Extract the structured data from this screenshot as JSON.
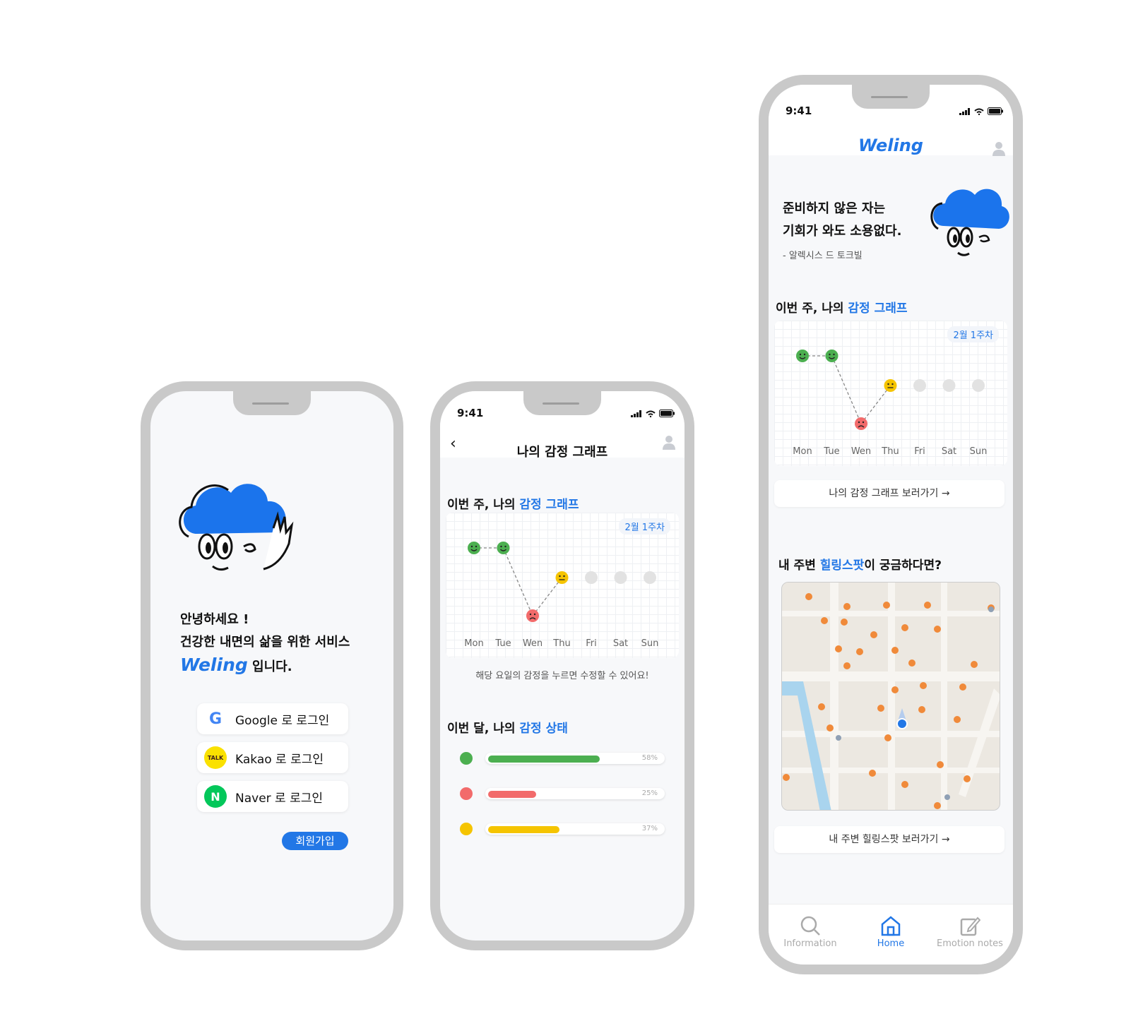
{
  "status": {
    "time": "9:41"
  },
  "login_screen": {
    "greeting_line1": "안녕하세요 !",
    "greeting_line2": "건강한 내면의 삶을 위한 서비스",
    "brand": "Weling",
    "greeting_suffix": "입니다.",
    "buttons": [
      {
        "label": "Google 로 로그인",
        "icon": "google-icon"
      },
      {
        "label": "Kakao 로 로그인",
        "icon": "kakao-icon"
      },
      {
        "label": "Naver 로 로그인",
        "icon": "naver-icon"
      }
    ],
    "signup_label": "회원가입",
    "kakao_icon_text": "TALK",
    "naver_icon_text": "N",
    "google_icon_text": "G"
  },
  "graph_screen": {
    "title": "나의 감정 그래프",
    "week_section": {
      "prefix": "이번 주, 나의 ",
      "highlight": "감정 그래프"
    },
    "week_pill": "2월 1주차",
    "days": [
      "Mon",
      "Tue",
      "Wen",
      "Thu",
      "Fri",
      "Sat",
      "Sun"
    ],
    "hint": "해당 요일의 감정을 누르면 수정할 수 있어요!",
    "month_section": {
      "prefix": "이번 달, 나의 ",
      "highlight": "감정 상태"
    },
    "month_bars": [
      {
        "mood": "happy",
        "percent": 58,
        "label": "58%",
        "color": "#4caf50"
      },
      {
        "mood": "sad",
        "percent": 25,
        "label": "25%",
        "color": "#f26b6b"
      },
      {
        "mood": "neutral",
        "percent": 37,
        "label": "37%",
        "color": "#f5c400"
      }
    ]
  },
  "home_screen": {
    "brand": "Weling",
    "quote_line1": "준비하지 않은 자는",
    "quote_line2": "기회가 와도 소용없다.",
    "quote_author": "- 알렉시스 드 토크빌",
    "week_section": {
      "prefix": "이번 주, 나의 ",
      "highlight": "감정 그래프"
    },
    "week_pill": "2월 1주차",
    "days": [
      "Mon",
      "Tue",
      "Wen",
      "Thu",
      "Fri",
      "Sat",
      "Sun"
    ],
    "graph_link": "나의 감정 그래프 보러가기 →",
    "spot_section": {
      "prefix": "내 주변 ",
      "highlight": "힐링스팟",
      "suffix": "이 궁금하다면?"
    },
    "spot_link": "내 주변 힐링스팟 보러가기 →",
    "tabs": [
      {
        "label": "Information",
        "icon": "search-icon",
        "active": false
      },
      {
        "label": "Home",
        "icon": "home-icon",
        "active": true
      },
      {
        "label": "Emotion notes",
        "icon": "edit-note-icon",
        "active": false
      }
    ]
  },
  "week_moods": [
    "happy",
    "happy",
    "sad",
    "neutral",
    "empty",
    "empty",
    "empty"
  ],
  "mood_colors": {
    "happy": "#4caf50",
    "sad": "#f26b6b",
    "neutral": "#f5c400",
    "empty": "#e2e2e2"
  },
  "accent": "#2277e6"
}
